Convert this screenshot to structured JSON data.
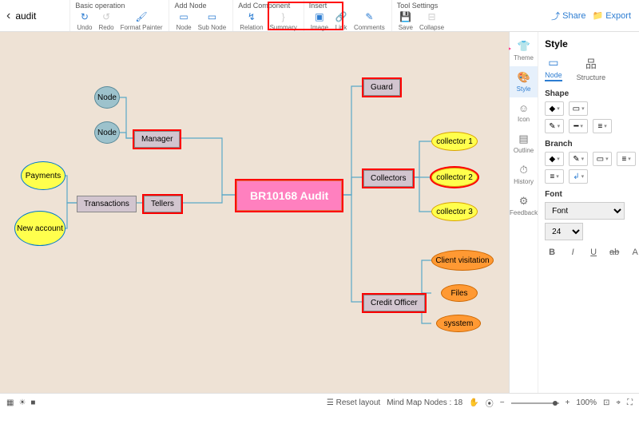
{
  "document": {
    "title": "audit"
  },
  "toolbar": {
    "groups": {
      "basic": {
        "label": "Basic operation",
        "undo": "Undo",
        "redo": "Redo",
        "format_painter": "Format Painter"
      },
      "add_node": {
        "label": "Add Node",
        "node": "Node",
        "sub_node": "Sub Node"
      },
      "add_component": {
        "label": "Add Component",
        "relation": "Relation",
        "summary": "Summary"
      },
      "insert": {
        "label": "Insert",
        "image": "Image",
        "link": "Link",
        "comments": "Comments"
      },
      "tool_settings": {
        "label": "Tool Settings",
        "save": "Save",
        "collapse": "Collapse"
      }
    },
    "share": "Share",
    "export": "Export"
  },
  "mindmap": {
    "root": "BR10168 Audit",
    "guard": "Guard",
    "collectors": {
      "label": "Collectors",
      "c1": "collector 1",
      "c2": "collector 2",
      "c3": "collector 3"
    },
    "credit_officer": {
      "label": "Credit Officer",
      "client_visitation": "Client visitation",
      "files": "Files",
      "sysstem": "sysstem"
    },
    "manager": {
      "label": "Manager",
      "node1": "Node",
      "node2": "Node"
    },
    "tellers": {
      "label": "Tellers",
      "transactions": "Transactions",
      "payments": "Payments",
      "new_account": "New account"
    }
  },
  "right_panel": {
    "title": "Style",
    "tabs": {
      "node": "Node",
      "structure": "Structure"
    },
    "side": {
      "theme": "Theme",
      "style": "Style",
      "icon": "Icon",
      "outline": "Outline",
      "history": "History",
      "feedback": "Feedback"
    },
    "shape": {
      "label": "Shape"
    },
    "branch": {
      "label": "Branch"
    },
    "font": {
      "label": "Font",
      "family": "Font",
      "size": "24"
    },
    "fmt": {
      "bold": "B",
      "italic": "I",
      "underline": "U",
      "strike": "ab",
      "color": "A"
    }
  },
  "statusbar": {
    "reset_layout": "Reset layout",
    "node_count_label": "Mind Map Nodes :",
    "node_count": "18",
    "zoom": "100%"
  }
}
